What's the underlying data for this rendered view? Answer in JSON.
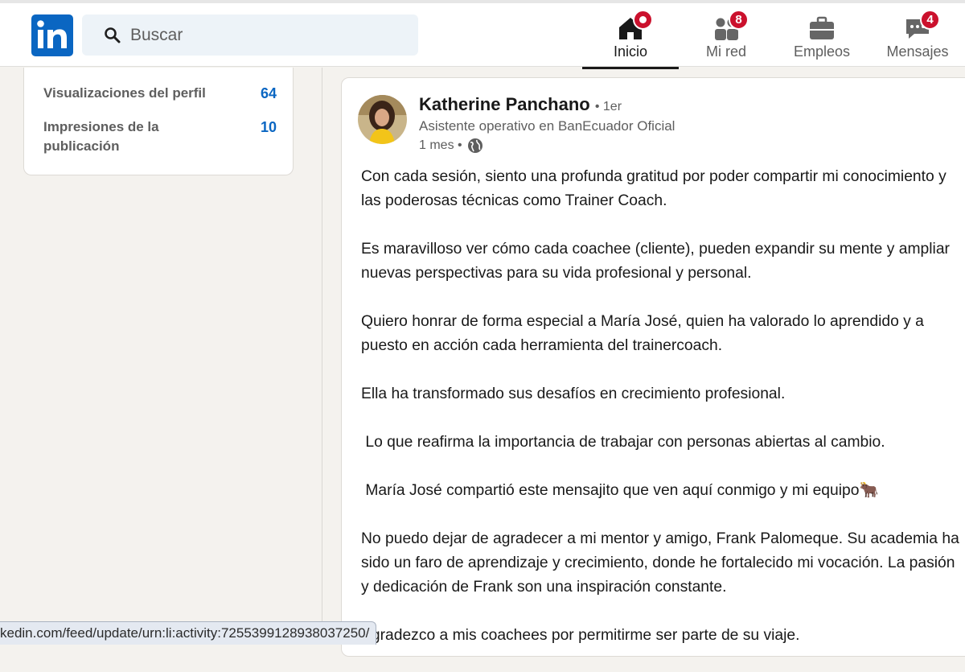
{
  "header": {
    "logo_text": "in",
    "search": {
      "placeholder": "Buscar",
      "icon": "search-icon"
    },
    "nav": [
      {
        "label": "Inicio",
        "icon": "home-icon",
        "badge": "",
        "active": true
      },
      {
        "label": "Mi red",
        "icon": "network-icon",
        "badge": "8",
        "active": false
      },
      {
        "label": "Empleos",
        "icon": "briefcase-icon",
        "badge": "",
        "active": false
      },
      {
        "label": "Mensajes",
        "icon": "messaging-icon",
        "badge": "4",
        "active": false
      }
    ],
    "colors": {
      "brand": "#0a66c2",
      "badge": "#cb112d"
    }
  },
  "sidebar": {
    "stats": [
      {
        "label": "Visualizaciones del perfil",
        "value": "64"
      },
      {
        "label": "Impresiones de la publicación",
        "value": "10"
      }
    ]
  },
  "post": {
    "author": {
      "name": "Katherine Panchano",
      "degree": "• 1er",
      "headline": "Asistente operativo en BanEcuador Oficial",
      "time": "1 mes •"
    },
    "paragraphs": [
      "Con cada sesión, siento una profunda gratitud por poder compartir mi conocimiento y las poderosas técnicas como Trainer Coach.",
      "Es maravilloso ver cómo cada coachee (cliente), pueden expandir su mente y ampliar nuevas perspectivas para su vida profesional y personal.",
      "Quiero honrar de forma especial a María José, quien ha valorado lo aprendido y a puesto en acción cada herramienta del trainercoach.",
      "Ella ha transformado sus desafíos en crecimiento profesional.",
      " Lo que reafirma la importancia de trabajar con personas abiertas al cambio.",
      " María José compartió este mensajito que ven aquí conmigo y mi equipo🐂",
      "No puedo dejar de agradecer a mi mentor y amigo, Frank Palomeque. Su academia ha sido un faro de aprendizaje y crecimiento, donde he fortalecido mi vocación. La pasión y dedicación de Frank son una inspiración constante.",
      "Agradezco a mis coachees por permitirme ser parte de su viaje."
    ]
  },
  "status_bar": {
    "url": "kedin.com/feed/update/urn:li:activity:7255399128938037250/"
  }
}
